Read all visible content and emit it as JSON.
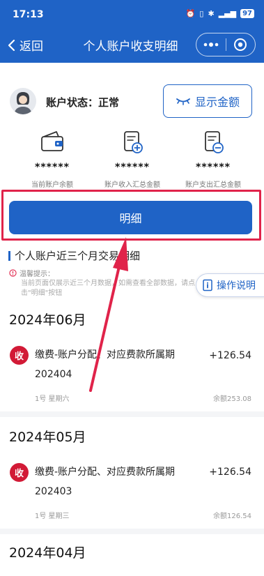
{
  "status_bar": {
    "time": "17:13",
    "battery": "97"
  },
  "nav": {
    "back_label": "返回",
    "title": "个人账户收支明细"
  },
  "account": {
    "status_label": "账户状态：正常",
    "show_amount_label": "显示金额"
  },
  "stats": [
    {
      "icon": "wallet-icon",
      "value": "******",
      "label": "当前账户余额"
    },
    {
      "icon": "income-document-icon",
      "value": "******",
      "label": "账户收入汇总金额"
    },
    {
      "icon": "expense-document-icon",
      "value": "******",
      "label": "账户支出汇总金额"
    }
  ],
  "detail_button_label": "明细",
  "section_title": "个人账户近三个月交易明细",
  "tip": {
    "title": "温馨提示：",
    "body": "当前页面仅展示近三个月数据，如需查看全部数据，请点击\"明细\"按钮"
  },
  "operation_button_label": "操作说明",
  "months": [
    {
      "label": "2024年06月",
      "records": [
        {
          "badge": "收",
          "description": "缴费-账户分配、对应费款所属期202404",
          "amount": "+126.54",
          "date": "1号 星期六",
          "balance": "余额253.08"
        }
      ]
    },
    {
      "label": "2024年05月",
      "records": [
        {
          "badge": "收",
          "description": "缴费-账户分配、对应费款所属期202403",
          "amount": "+126.54",
          "date": "1号 星期三",
          "balance": "余额126.54"
        }
      ]
    },
    {
      "label": "2024年04月",
      "records": []
    }
  ],
  "colors": {
    "primary": "#1f63c6",
    "highlight": "#e0234a",
    "badge": "#d21a36"
  }
}
